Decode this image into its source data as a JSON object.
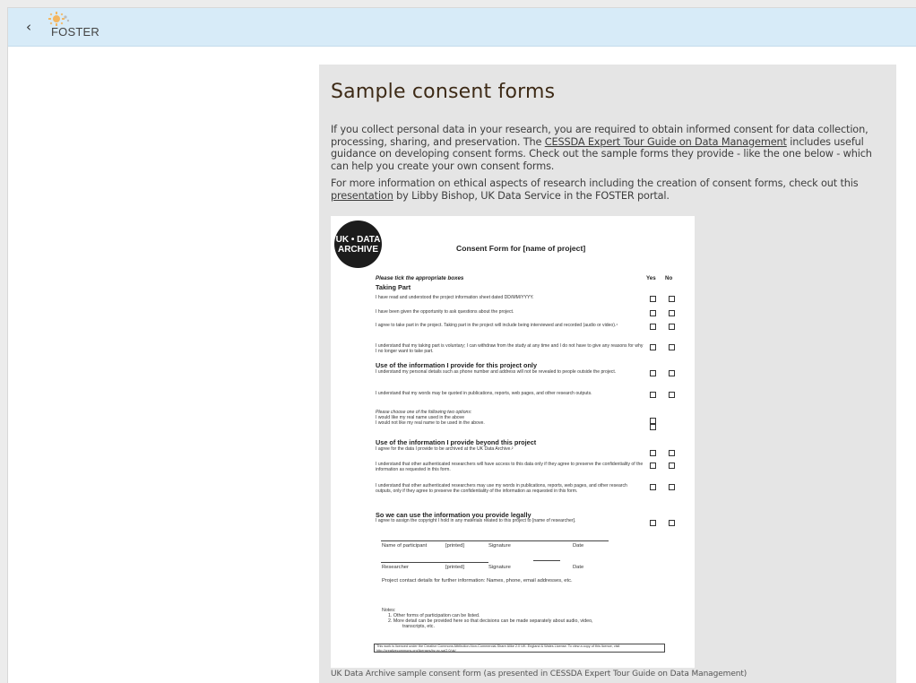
{
  "app": {
    "back_glyph": "‹",
    "logo_text": "FOSTER",
    "logo_icon": "foster-sun-logo-icon",
    "topbar_color": "#d7ebf8"
  },
  "content": {
    "title": "Sample consent forms",
    "para1_before": "If you collect personal data in your research, you are required to obtain informed consent for data collection, processing, sharing, and preservation. The ",
    "para1_link": "CESSDA Expert Tour Guide on Data Management",
    "para1_after": " includes useful guidance on developing consent forms. Check out the sample forms they provide - like the one below - which can help you create your own consent forms.",
    "para2_before": "For more information on ethical aspects of research including the creation of consent forms, check out this ",
    "para2_link": "presentation",
    "para2_after": " by Libby Bishop, UK Data Service in the FOSTER portal.",
    "caption": "UK Data Archive sample consent form (as presented in CESSDA Expert Tour Guide on Data Management)"
  },
  "form": {
    "badge_line1": "UK • DATA",
    "badge_line2": "ARCHIVE",
    "title": "Consent Form for [name of project]",
    "instructions": "Please tick the appropriate boxes",
    "col_yes": "Yes",
    "col_no": "No",
    "sec_taking_part": "Taking Part",
    "row1": "I have read and understood the project information sheet dated DD/MM/YYYY.",
    "row2": "I have been given the opportunity to ask questions about the project.",
    "row3": "I agree to take part in the project.  Taking part in the project will include being interviewed and recorded (audio or video).¹",
    "row4": "I understand that my taking part is voluntary; I can withdraw from the study at any time and I do not have to give any reasons for why I no longer want to take part.",
    "sec_use_this": "Use of the information I provide for this project only",
    "row5": "I understand my personal details such as phone number and address will not be revealed to people outside the project.",
    "row6": "I understand that my words may be quoted in publications, reports, web pages, and other research outputs.",
    "row7a": "Please choose one of the following two options:",
    "row7b": "I would like my real name used in the above",
    "row7c": "I would not like my real name to be used in the above.",
    "sec_use_beyond": "Use of the information I provide beyond this project",
    "row8": "I agree for the data I provide to be archived at the UK Data Archive.²",
    "row9": "I understand that other authenticated researchers will have access to this data only if they agree to preserve the confidentiality of the information as requested in this form.",
    "row10": "I understand that other authenticated researchers may use my words in publications, reports, web pages, and other research outputs, only if they agree to preserve the confidentiality of the information as requested in this form.",
    "sec_legal": "So we can use the information you provide legally",
    "row11": "I agree to assign the copyright I hold in any materials related to this project to [name of researcher].",
    "sig_participant": "Name of participant",
    "sig_printed1": "[printed]",
    "sig_signature1": "Signature",
    "sig_date1": "Date",
    "sig_researcher": "Researcher",
    "sig_printed2": "[printed]",
    "sig_signature2": "Signature",
    "sig_date2": "Date",
    "contact": "Project contact details for further information:  Names, phone, email addresses, etc.",
    "notes_label": "Notes:",
    "note1": "1.    Other forms of participation can be listed.",
    "note2": "2.    More detail can be provided here so that decisions can be made separately about audio, video,",
    "note2b": "transcripts, etc.",
    "licence": "This work is licenced under the Creative Commons Attribution-Non-Commercial-Share Alike 2.0 UK: England & Wales License. To view a copy of this licence, visit http://creativecommons.org/licenses/by-nc-sa/2.0/uk/"
  }
}
